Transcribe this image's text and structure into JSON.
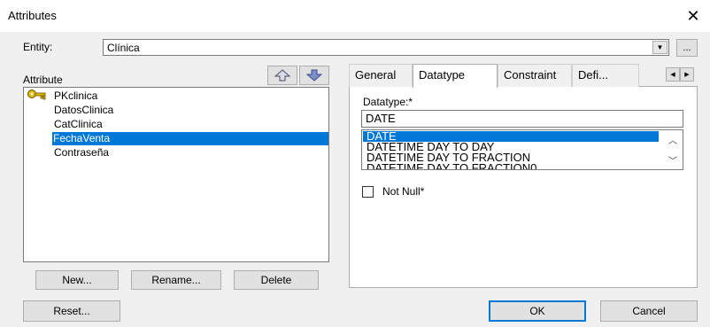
{
  "window": {
    "title": "Attributes",
    "close_glyph": "✕"
  },
  "entity": {
    "label": "Entity:",
    "value": "Clínica",
    "browse_label": "..."
  },
  "attributes": {
    "header": "Attribute",
    "items": [
      {
        "name": "PKclinica",
        "icon": "key-icon",
        "selected": false
      },
      {
        "name": "DatosClinica",
        "selected": false
      },
      {
        "name": "CatClinica",
        "selected": false
      },
      {
        "name": "FechaVenta",
        "selected": true
      },
      {
        "name": "Contraseña",
        "selected": false
      }
    ],
    "move_up_icon": "arrow-up-icon",
    "move_down_icon": "arrow-down-icon",
    "new_label": "New...",
    "rename_label": "Rename...",
    "delete_label": "Delete"
  },
  "tabs": [
    {
      "label": "General",
      "active": false
    },
    {
      "label": "Datatype",
      "active": true
    },
    {
      "label": "Constraint",
      "active": false
    },
    {
      "label": "Defi...",
      "active": false
    }
  ],
  "datatype": {
    "label": "Datatype:*",
    "value": "DATE",
    "options": [
      "DATE",
      "DATETIME DAY TO DAY",
      "DATETIME DAY TO FRACTION",
      "DATETIME DAY TO FRACTION0"
    ],
    "selected_index": 0
  },
  "not_null": {
    "label": "Not Null*",
    "checked": false
  },
  "footer": {
    "reset_label": "Reset...",
    "ok_label": "OK",
    "cancel_label": "Cancel"
  },
  "colors": {
    "selection": "#0078d7",
    "dialog_bg": "#f0f0f0",
    "button_bg": "#e1e1e1"
  }
}
